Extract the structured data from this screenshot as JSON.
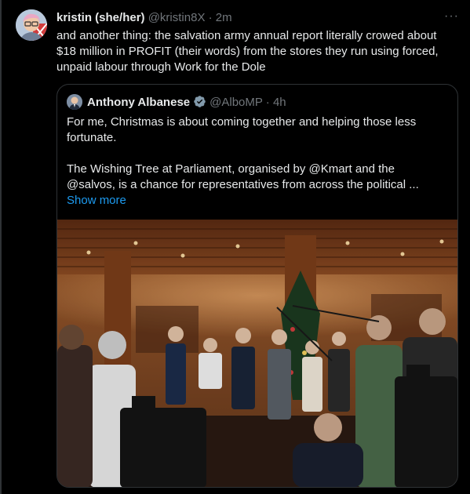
{
  "tweet": {
    "display_name": "kristin (she/her)",
    "handle": "@kristin8X",
    "separator": "·",
    "time": "2m",
    "more_label": "···",
    "text": "and another thing: the salvation army annual report literally crowed about $18 million in PROFIT (their words) from the stores they run using forced, unpaid labour through Work for the Dole"
  },
  "quote": {
    "display_name": "Anthony Albanese",
    "handle": "@AlboMP",
    "separator": "·",
    "time": "4h",
    "paragraph_1": "For me, Christmas is about coming together and helping those less fortunate.",
    "paragraph_2": "The Wishing Tree at Parliament, organised by @Kmart  and the @salvos, is a chance for representatives from across the political ...",
    "show_more": "Show more",
    "verified_color": "#829aab"
  },
  "colors": {
    "background": "#000000",
    "text": "#e7e9ea",
    "muted": "#71767b",
    "link": "#1d9bf0",
    "border": "#2f3336"
  }
}
